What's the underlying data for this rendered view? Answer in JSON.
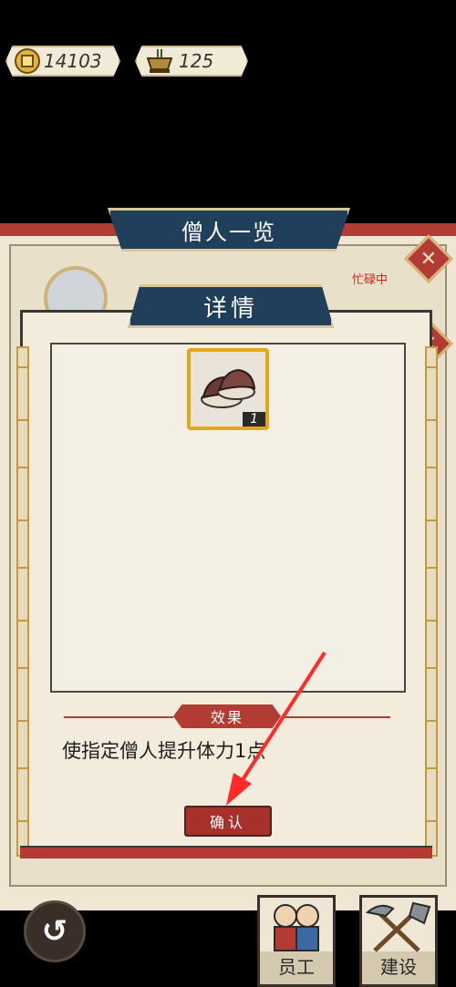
{
  "currency": {
    "coins": "14103",
    "incense": "125"
  },
  "background_panel": {
    "title": "僧人一览",
    "status": "忙碌中"
  },
  "dialog": {
    "title": "详情",
    "item": {
      "name": "shoes",
      "quantity": "1"
    },
    "effect_label": "效果",
    "effect_text": "使指定僧人提升体力1点",
    "confirm_label": "确认"
  },
  "bottom_nav": {
    "staff_label": "员工",
    "build_label": "建设"
  },
  "colors": {
    "banner": "#1f3f5a",
    "accent_red": "#b23b33",
    "gold": "#e4a716",
    "arrow": "#ff2a2a"
  }
}
